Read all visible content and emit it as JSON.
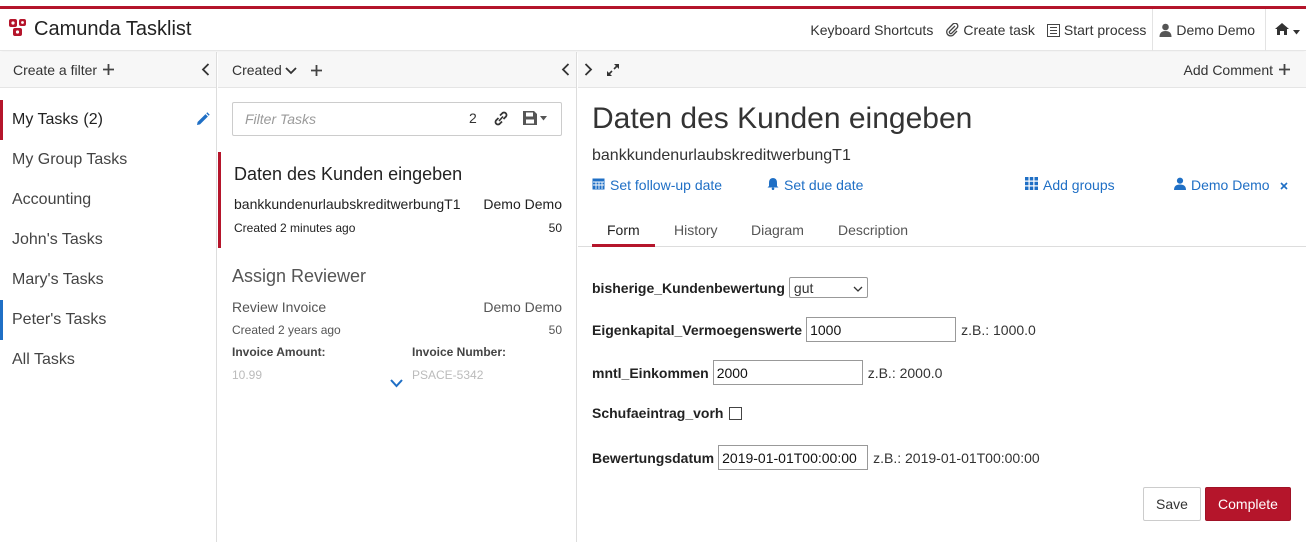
{
  "app": {
    "title": "Camunda Tasklist"
  },
  "header_nav": {
    "keyboard_shortcuts": "Keyboard Shortcuts",
    "create_task": "Create task",
    "start_process": "Start process",
    "user": "Demo Demo"
  },
  "filters_panel": {
    "create_filter": "Create a filter",
    "items": [
      {
        "label": "My Tasks",
        "count": "(2)"
      },
      {
        "label": "My Group Tasks"
      },
      {
        "label": "Accounting"
      },
      {
        "label": "John's Tasks"
      },
      {
        "label": "Mary's Tasks"
      },
      {
        "label": "Peter's Tasks"
      },
      {
        "label": "All Tasks"
      }
    ]
  },
  "task_list": {
    "sort_label": "Created",
    "search_placeholder": "Filter Tasks",
    "result_count": "2",
    "tasks": [
      {
        "name": "Daten des Kunden eingeben",
        "process": "bankkundenurlaubskreditwerbungT1",
        "assignee": "Demo Demo",
        "created": "Created 2 minutes ago",
        "priority": "50"
      },
      {
        "name": "Assign Reviewer",
        "process": "Review Invoice",
        "assignee": "Demo Demo",
        "created": "Created 2 years ago",
        "priority": "50",
        "vars": [
          {
            "label": "Invoice Amount:",
            "value": "10.99"
          },
          {
            "label": "Invoice Number:",
            "value": "PSACE-5342"
          }
        ]
      }
    ]
  },
  "task_detail": {
    "add_comment": "Add Comment",
    "title": "Daten des Kunden eingeben",
    "process": "bankkundenurlaubskreditwerbungT1",
    "actions": {
      "follow_up": "Set follow-up date",
      "due": "Set due date",
      "groups": "Add groups",
      "assignee": "Demo Demo"
    },
    "tabs": [
      "Form",
      "History",
      "Diagram",
      "Description"
    ],
    "form": {
      "kundenbewertung": {
        "label": "bisherige_Kundenbewertung",
        "value": "gut"
      },
      "eigenkapital": {
        "label": "Eigenkapital_Vermoegenswerte",
        "value": "1000",
        "hint": "z.B.: 1000.0"
      },
      "einkommen": {
        "label": "mntl_Einkommen",
        "value": "2000",
        "hint": "z.B.: 2000.0"
      },
      "schufa": {
        "label": "Schufaeintrag_vorh"
      },
      "datum": {
        "label": "Bewertungsdatum",
        "value": "2019-01-01T00:00:00",
        "hint": "z.B.: 2019-01-01T00:00:00"
      }
    },
    "buttons": {
      "save": "Save",
      "complete": "Complete"
    }
  },
  "colors": {
    "brand": "#b5152b",
    "link": "#1f6fc5"
  }
}
